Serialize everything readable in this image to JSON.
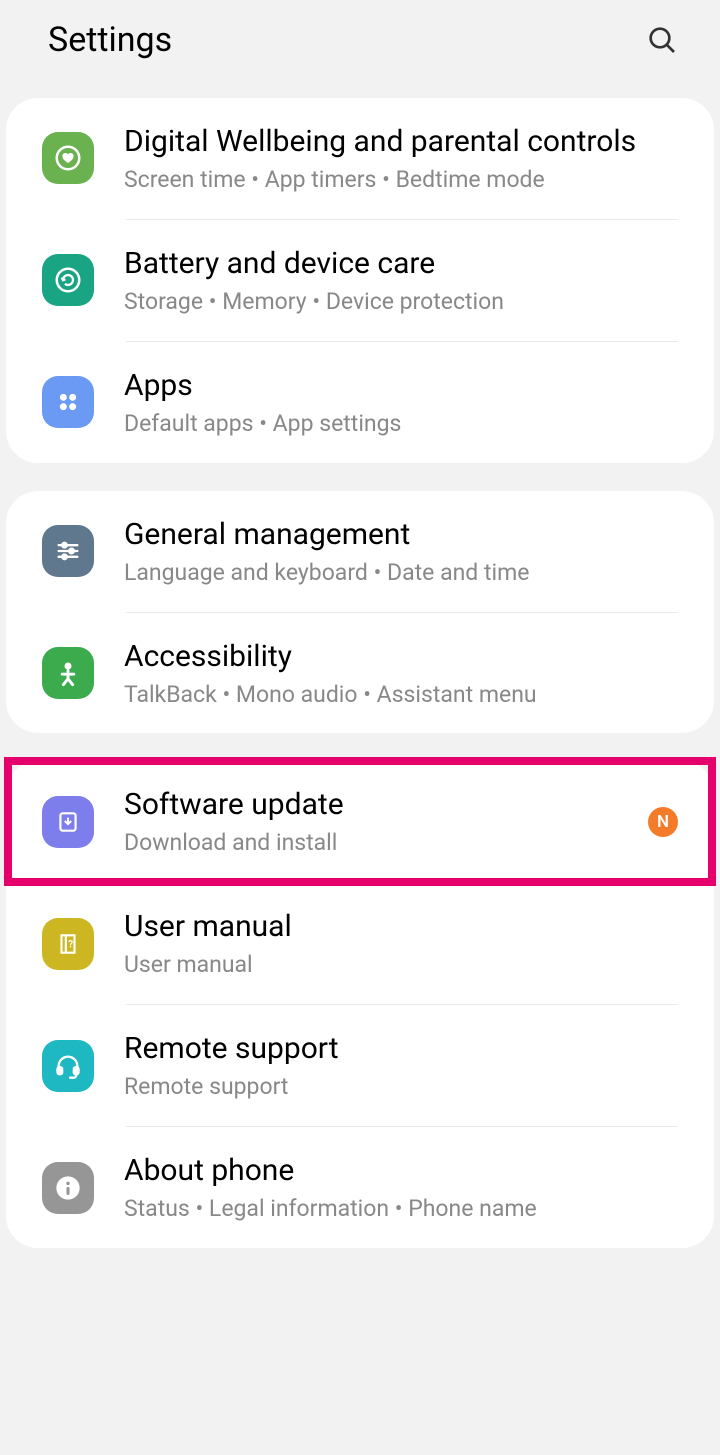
{
  "header": {
    "title": "Settings"
  },
  "groups": [
    {
      "items": [
        {
          "id": "digital-wellbeing",
          "iconClass": "ic-wellbeing",
          "iconName": "heart-circle-icon",
          "title": "Digital Wellbeing and parental controls",
          "subtitle": "Screen time  •  App timers  •  Bedtime mode"
        },
        {
          "id": "battery-device-care",
          "iconClass": "ic-battery",
          "iconName": "refresh-circle-icon",
          "title": "Battery and device care",
          "subtitle": "Storage  •  Memory  •  Device protection"
        },
        {
          "id": "apps",
          "iconClass": "ic-apps",
          "iconName": "apps-grid-icon",
          "title": "Apps",
          "subtitle": "Default apps  •  App settings"
        }
      ]
    },
    {
      "items": [
        {
          "id": "general-management",
          "iconClass": "ic-general",
          "iconName": "sliders-icon",
          "title": "General management",
          "subtitle": "Language and keyboard  •  Date and time"
        },
        {
          "id": "accessibility",
          "iconClass": "ic-accessibility",
          "iconName": "person-icon",
          "title": "Accessibility",
          "subtitle": "TalkBack  •  Mono audio  •  Assistant menu"
        }
      ]
    },
    {
      "items": [
        {
          "id": "software-update",
          "iconClass": "ic-software",
          "iconName": "download-update-icon",
          "title": "Software update",
          "subtitle": "Download and install",
          "badge": "N",
          "highlighted": true
        },
        {
          "id": "user-manual",
          "iconClass": "ic-manual",
          "iconName": "book-help-icon",
          "title": "User manual",
          "subtitle": "User manual"
        },
        {
          "id": "remote-support",
          "iconClass": "ic-remote",
          "iconName": "headset-icon",
          "title": "Remote support",
          "subtitle": "Remote support"
        },
        {
          "id": "about-phone",
          "iconClass": "ic-about",
          "iconName": "info-icon",
          "title": "About phone",
          "subtitle": "Status  •  Legal information  •  Phone name"
        }
      ]
    }
  ]
}
